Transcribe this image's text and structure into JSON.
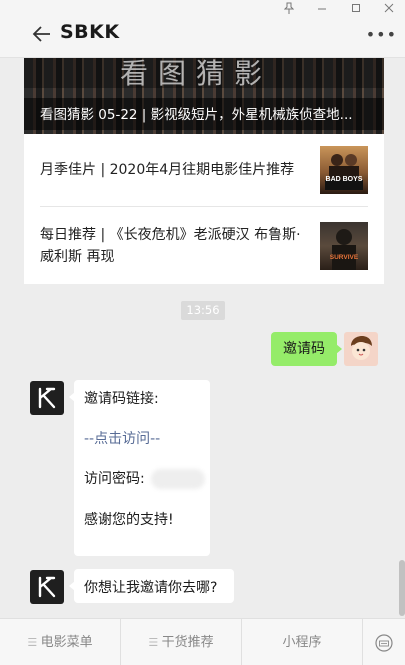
{
  "window": {
    "pin_icon": "pin-icon",
    "min_icon": "minimize-icon",
    "max_icon": "maximize-icon",
    "close_icon": "close-icon"
  },
  "header": {
    "title": "SBKK",
    "back_icon": "arrow-left-icon",
    "more_icon": "more-dots-icon"
  },
  "articles": {
    "banner_text": "看图猜影",
    "banner_caption": "看图猜影 05-22 | 影视级短片，外星机械族侦查地...",
    "items": [
      {
        "title": "月季佳片 | 2020年4月往期电影佳片推荐",
        "thumb_text": "BAD BOYS"
      },
      {
        "title": "每日推荐 | 《长夜危机》老派硬汉 布鲁斯·威利斯 再现",
        "thumb_text": "SURVIVE"
      }
    ]
  },
  "chat": {
    "timestamp": "13:56",
    "user_message": "邀请码",
    "bot_message_1": {
      "line1": "邀请码链接:",
      "line2_prefix": "--",
      "line2_link": "点击访问",
      "line2_suffix": "--",
      "line3": "访问密码:",
      "line4": "感谢您的支持!"
    },
    "bot_message_2": "你想让我邀请你去哪?"
  },
  "bottom_menu": {
    "items": [
      "电影菜单",
      "干货推荐",
      "小程序"
    ],
    "keyboard_icon": "keyboard-toggle-icon"
  },
  "colors": {
    "bubble_green": "#95ec69",
    "link": "#576b95",
    "background": "#ededed"
  }
}
